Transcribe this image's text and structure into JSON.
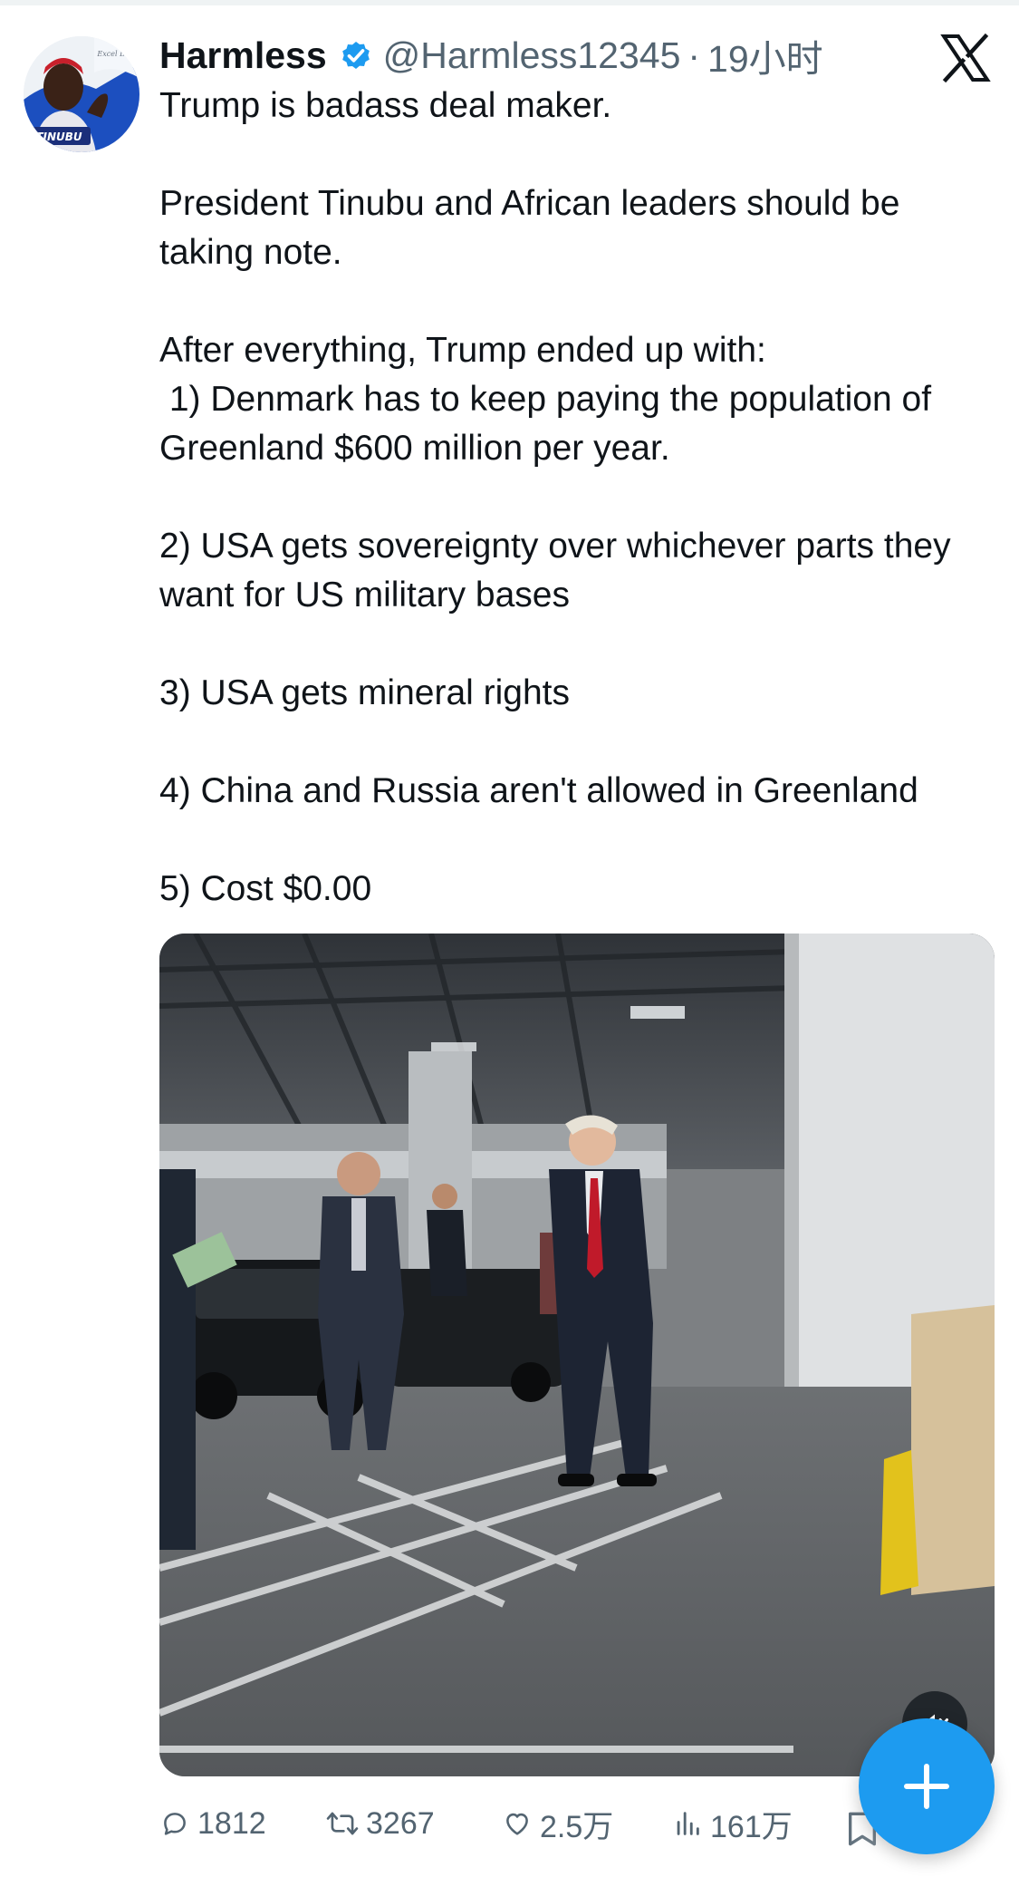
{
  "post": {
    "display_name": "Harmless",
    "handle": "@Harmless12345",
    "separator": "·",
    "time": "19小时",
    "text_lines": [
      "Trump is badass deal maker.",
      "",
      "President Tinubu and African leaders should be taking note.",
      "",
      "After everything, Trump ended up with:",
      " 1) Denmark has to keep paying the population of Greenland $600 million per year.",
      "",
      "2) USA gets sovereignty over whichever parts they want for US military bases",
      "",
      "3) USA gets mineral rights",
      "",
      "4) China and Russia aren't allowed in Greenland",
      "",
      "5) Cost $0.00"
    ]
  },
  "avatar": {
    "sign_text": "TINUBU",
    "badge_text": "Excel Leader"
  },
  "actions": {
    "replies": "1812",
    "reposts": "3267",
    "likes": "2.5万",
    "views": "161万"
  },
  "icons": {
    "verified": "verified-badge-icon",
    "platform": "x-logo-icon",
    "reply": "reply-icon",
    "repost": "repost-icon",
    "like": "heart-icon",
    "views": "views-chart-icon",
    "mute": "speaker-mute-icon",
    "compose": "plus-icon",
    "bookmark": "bookmark-icon"
  },
  "colors": {
    "accent": "#1d9bf0",
    "text": "#0f1419",
    "secondary": "#536471"
  }
}
